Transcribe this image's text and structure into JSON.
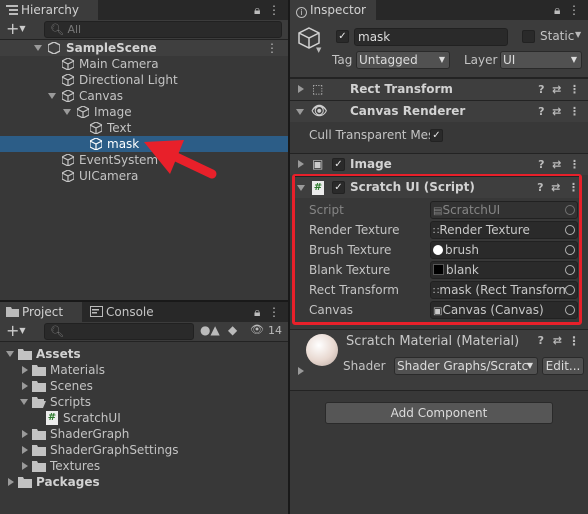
{
  "hierarchy": {
    "tab": "Hierarchy",
    "search_placeholder": "All",
    "items": [
      {
        "label": "SampleScene"
      },
      {
        "label": "Main Camera"
      },
      {
        "label": "Directional Light"
      },
      {
        "label": "Canvas"
      },
      {
        "label": "Image"
      },
      {
        "label": "Text"
      },
      {
        "label": "mask"
      },
      {
        "label": "EventSystem"
      },
      {
        "label": "UICamera"
      }
    ]
  },
  "project": {
    "tabs": [
      {
        "label": "Project"
      },
      {
        "label": "Console"
      }
    ],
    "hidden_count": "14",
    "items": [
      {
        "label": "Assets"
      },
      {
        "label": "Materials"
      },
      {
        "label": "Scenes"
      },
      {
        "label": "Scripts"
      },
      {
        "label": "ScratchUI"
      },
      {
        "label": "ShaderGraph"
      },
      {
        "label": "ShaderGraphSettings"
      },
      {
        "label": "Textures"
      },
      {
        "label": "Packages"
      }
    ]
  },
  "inspector": {
    "tab": "Inspector",
    "object_name": "mask",
    "static_label": "Static",
    "tag_label": "Tag",
    "tag_value": "Untagged",
    "layer_label": "Layer",
    "layer_value": "UI",
    "components": {
      "rect_transform": "Rect Transform",
      "canvas_renderer": "Canvas Renderer",
      "cull_label": "Cull Transparent Mes",
      "image": "Image",
      "scratch": "Scratch UI (Script)"
    },
    "scratch_props": [
      {
        "name": "Script",
        "value": "ScratchUI"
      },
      {
        "name": "Render Texture",
        "value": "Render Texture"
      },
      {
        "name": "Brush Texture",
        "value": "brush"
      },
      {
        "name": "Blank Texture",
        "value": "blank"
      },
      {
        "name": "Rect Transform",
        "value": "mask (Rect Transform"
      },
      {
        "name": "Canvas",
        "value": "Canvas (Canvas)"
      }
    ],
    "material": {
      "title": "Scratch Material (Material)",
      "shader_label": "Shader",
      "shader_value": "Shader Graphs/Scratc",
      "edit_label": "Edit..."
    },
    "add_component": "Add Component"
  },
  "colors": {
    "highlight": "#e8202a",
    "selection": "#2c5d87",
    "panel": "#383838"
  }
}
